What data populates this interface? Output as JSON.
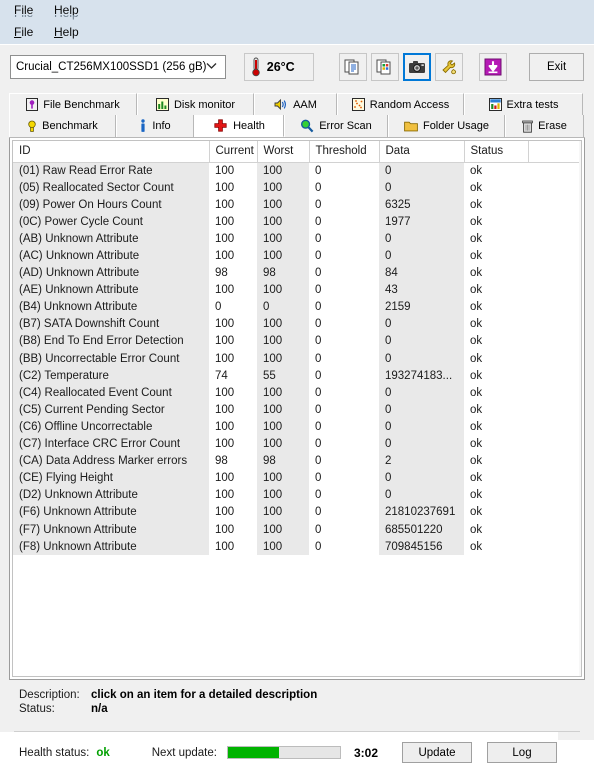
{
  "menubar": {
    "items": [
      "File",
      "Help"
    ],
    "mnemonics": [
      "F",
      "H"
    ],
    "ghost_fragment": "File      Help"
  },
  "toolbar": {
    "drive": {
      "value": "Crucial_CT256MX100SSD1 (256 gB)",
      "chevron_icon": "chevron-down-icon"
    },
    "temperature": {
      "value": "26°C",
      "icon": "thermometer-icon"
    },
    "buttons": [
      {
        "name": "copy-text-report-icon",
        "icon": "document-copy-icon"
      },
      {
        "name": "copy-excel-report-icon",
        "icon": "document-excel-icon"
      },
      {
        "name": "screenshot-icon",
        "icon": "camera-icon",
        "focused": true
      },
      {
        "name": "tweak-icon",
        "icon": "wrench-icon"
      },
      {
        "name": "download-icon",
        "icon": "down-arrow-icon"
      }
    ],
    "exit_label": "Exit"
  },
  "tabs": {
    "row1": [
      {
        "label": "File Benchmark",
        "icon": "file-benchmark-icon",
        "active": false
      },
      {
        "label": "Disk monitor",
        "icon": "bar-chart-icon",
        "active": false
      },
      {
        "label": "AAM",
        "icon": "speaker-icon",
        "active": false
      },
      {
        "label": "Random Access",
        "icon": "scatter-icon",
        "active": false
      },
      {
        "label": "Extra tests",
        "icon": "extra-tests-icon",
        "active": false
      }
    ],
    "row2": [
      {
        "label": "Benchmark",
        "icon": "bulb-icon",
        "active": false
      },
      {
        "label": "Info",
        "icon": "info-icon",
        "active": false
      },
      {
        "label": "Health",
        "icon": "red-cross-icon",
        "active": true
      },
      {
        "label": "Error Scan",
        "icon": "magnifier-icon",
        "active": false
      },
      {
        "label": "Folder Usage",
        "icon": "folder-icon",
        "active": false
      },
      {
        "label": "Erase",
        "icon": "trash-icon",
        "active": false
      }
    ]
  },
  "table": {
    "columns": [
      "ID",
      "Current",
      "Worst",
      "Threshold",
      "Data",
      "Status"
    ],
    "rows": [
      {
        "id": "(01) Raw Read Error Rate",
        "current": "100",
        "worst": "100",
        "threshold": "0",
        "data": "0",
        "status": "ok"
      },
      {
        "id": "(05) Reallocated Sector Count",
        "current": "100",
        "worst": "100",
        "threshold": "0",
        "data": "0",
        "status": "ok"
      },
      {
        "id": "(09) Power On Hours Count",
        "current": "100",
        "worst": "100",
        "threshold": "0",
        "data": "6325",
        "status": "ok"
      },
      {
        "id": "(0C) Power Cycle Count",
        "current": "100",
        "worst": "100",
        "threshold": "0",
        "data": "1977",
        "status": "ok"
      },
      {
        "id": "(AB) Unknown Attribute",
        "current": "100",
        "worst": "100",
        "threshold": "0",
        "data": "0",
        "status": "ok"
      },
      {
        "id": "(AC) Unknown Attribute",
        "current": "100",
        "worst": "100",
        "threshold": "0",
        "data": "0",
        "status": "ok"
      },
      {
        "id": "(AD) Unknown Attribute",
        "current": "98",
        "worst": "98",
        "threshold": "0",
        "data": "84",
        "status": "ok"
      },
      {
        "id": "(AE) Unknown Attribute",
        "current": "100",
        "worst": "100",
        "threshold": "0",
        "data": "43",
        "status": "ok"
      },
      {
        "id": "(B4) Unknown Attribute",
        "current": "0",
        "worst": "0",
        "threshold": "0",
        "data": "2159",
        "status": "ok"
      },
      {
        "id": "(B7) SATA Downshift Count",
        "current": "100",
        "worst": "100",
        "threshold": "0",
        "data": "0",
        "status": "ok"
      },
      {
        "id": "(B8) End To End Error Detection",
        "current": "100",
        "worst": "100",
        "threshold": "0",
        "data": "0",
        "status": "ok"
      },
      {
        "id": "(BB) Uncorrectable Error Count",
        "current": "100",
        "worst": "100",
        "threshold": "0",
        "data": "0",
        "status": "ok"
      },
      {
        "id": "(C2) Temperature",
        "current": "74",
        "worst": "55",
        "threshold": "0",
        "data": "193274183...",
        "status": "ok"
      },
      {
        "id": "(C4) Reallocated Event Count",
        "current": "100",
        "worst": "100",
        "threshold": "0",
        "data": "0",
        "status": "ok"
      },
      {
        "id": "(C5) Current Pending Sector",
        "current": "100",
        "worst": "100",
        "threshold": "0",
        "data": "0",
        "status": "ok"
      },
      {
        "id": "(C6) Offline Uncorrectable",
        "current": "100",
        "worst": "100",
        "threshold": "0",
        "data": "0",
        "status": "ok"
      },
      {
        "id": "(C7) Interface CRC Error Count",
        "current": "100",
        "worst": "100",
        "threshold": "0",
        "data": "0",
        "status": "ok"
      },
      {
        "id": "(CA) Data Address Marker errors",
        "current": "98",
        "worst": "98",
        "threshold": "0",
        "data": "2",
        "status": "ok"
      },
      {
        "id": "(CE) Flying Height",
        "current": "100",
        "worst": "100",
        "threshold": "0",
        "data": "0",
        "status": "ok"
      },
      {
        "id": "(D2) Unknown Attribute",
        "current": "100",
        "worst": "100",
        "threshold": "0",
        "data": "0",
        "status": "ok"
      },
      {
        "id": "(F6) Unknown Attribute",
        "current": "100",
        "worst": "100",
        "threshold": "0",
        "data": "21810237691",
        "status": "ok"
      },
      {
        "id": "(F7) Unknown Attribute",
        "current": "100",
        "worst": "100",
        "threshold": "0",
        "data": "685501220",
        "status": "ok"
      },
      {
        "id": "(F8) Unknown Attribute",
        "current": "100",
        "worst": "100",
        "threshold": "0",
        "data": "709845156",
        "status": "ok"
      }
    ]
  },
  "details": {
    "description_label": "Description:",
    "description_value": "click on an item for a detailed description",
    "status_label": "Status:",
    "status_value": "n/a"
  },
  "statusbar": {
    "health_label": "Health status:",
    "health_value": "ok",
    "health_color": "#00a000",
    "next_update_label": "Next update:",
    "progress_percent": 46,
    "progress_color": "#00b300",
    "time_remaining": "3:02",
    "update_label": "Update",
    "log_label": "Log"
  }
}
